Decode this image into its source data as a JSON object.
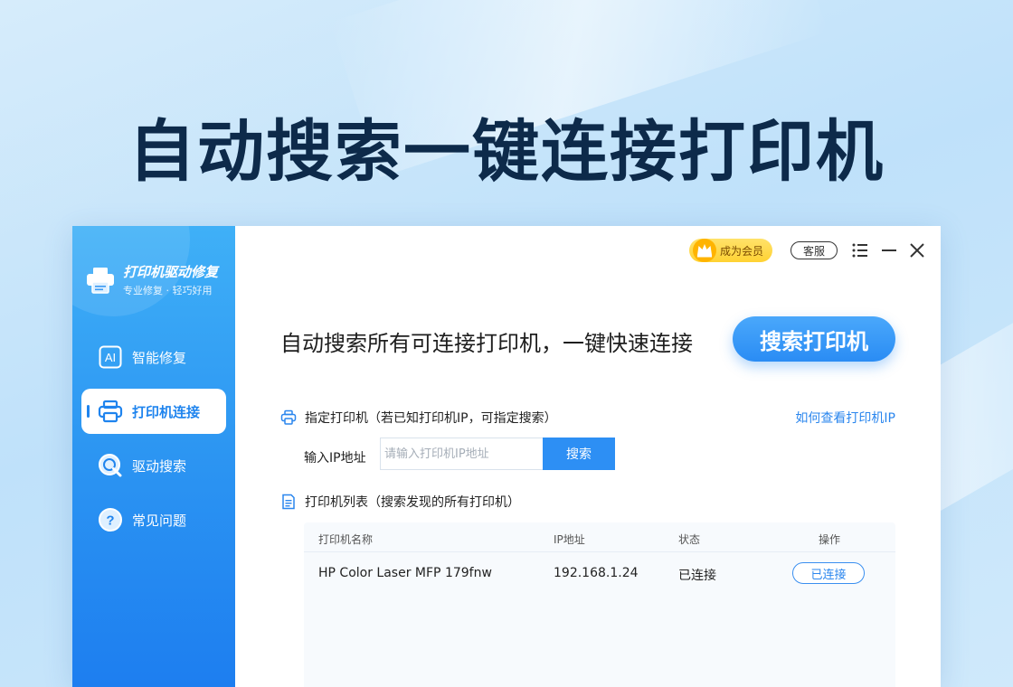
{
  "hero": {
    "title": "自动搜索一键连接打印机"
  },
  "brand": {
    "name": "打印机驱动修复",
    "tagline": "专业修复 · 轻巧好用"
  },
  "sidebar": {
    "items": [
      {
        "label": "智能修复",
        "icon": "ai-icon",
        "active": false
      },
      {
        "label": "打印机连接",
        "icon": "printer-icon",
        "active": true
      },
      {
        "label": "驱动搜索",
        "icon": "search-icon",
        "active": false
      },
      {
        "label": "常见问题",
        "icon": "question-icon",
        "active": false
      }
    ]
  },
  "topbar": {
    "vip_label": "成为会员",
    "service_label": "客服",
    "icons": [
      "crown-icon",
      "menu-icon",
      "minimize-icon",
      "close-icon"
    ]
  },
  "main": {
    "headline": "自动搜索所有可连接打印机，一键快速连接",
    "search_button": "搜索打印机",
    "specify_section": "指定打印机（若已知打印机IP，可指定搜索）",
    "help_link": "如何查看打印机IP",
    "ip_label": "输入IP地址",
    "ip_placeholder": "请输入打印机IP地址",
    "ip_value": "",
    "ip_search_button": "搜索",
    "list_section": "打印机列表（搜索发现的所有打印机）"
  },
  "table": {
    "headers": [
      "打印机名称",
      "IP地址",
      "状态",
      "操作"
    ],
    "rows": [
      {
        "name": "HP Color Laser MFP 179fnw",
        "ip": "192.168.1.24",
        "status": "已连接",
        "action": "已连接"
      }
    ]
  },
  "colors": {
    "accent": "#2a8cf4",
    "sidebar_top": "#3fb0f7",
    "sidebar_bottom": "#1d7ef0",
    "title": "#0d2a4a",
    "vip": "#ffd233"
  }
}
